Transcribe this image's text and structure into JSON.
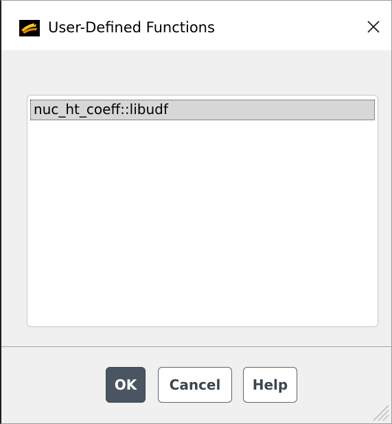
{
  "window": {
    "title": "User-Defined Functions",
    "close_icon": "close-icon",
    "app_icon": "fluent-app-icon"
  },
  "list": {
    "items": [
      {
        "label": "nuc_ht_coeff::libudf",
        "selected": true
      }
    ]
  },
  "buttons": {
    "ok_label": "OK",
    "cancel_label": "Cancel",
    "help_label": "Help"
  },
  "colors": {
    "primary_button": "#4a5561",
    "selection": "#d7d7d7",
    "dialog_background": "#f0f0f0"
  }
}
